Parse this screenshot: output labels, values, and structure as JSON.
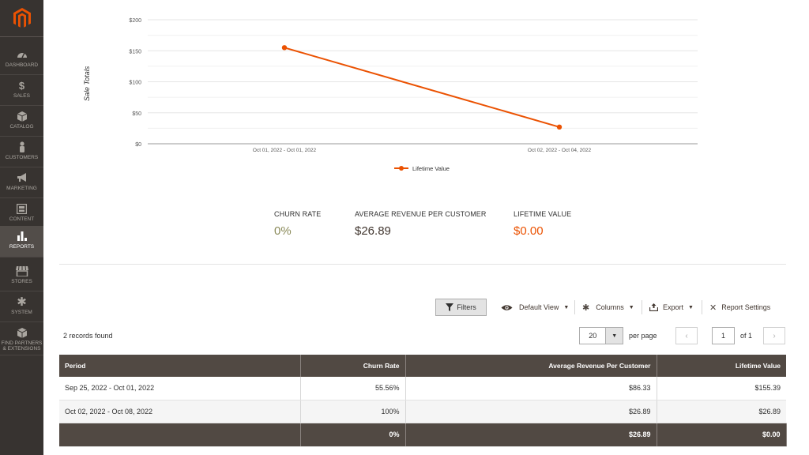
{
  "sidebar": {
    "items": [
      {
        "label": "DASHBOARD",
        "icon": "dashboard-icon"
      },
      {
        "label": "SALES",
        "icon": "dollar-icon"
      },
      {
        "label": "CATALOG",
        "icon": "box-icon"
      },
      {
        "label": "CUSTOMERS",
        "icon": "person-icon"
      },
      {
        "label": "MARKETING",
        "icon": "megaphone-icon"
      },
      {
        "label": "CONTENT",
        "icon": "layout-icon"
      },
      {
        "label": "REPORTS",
        "icon": "bar-chart-icon"
      },
      {
        "label": "STORES",
        "icon": "store-icon"
      },
      {
        "label": "SYSTEM",
        "icon": "gear-icon"
      },
      {
        "label": "FIND PARTNERS & EXTENSIONS",
        "icon": "cube-icon"
      }
    ],
    "active_item": "REPORTS",
    "colors": {
      "bg": "#373330",
      "active": "#524d49",
      "logo": "#eb5202"
    }
  },
  "chart_data": {
    "type": "line",
    "categories": [
      "Oct 01, 2022 - Oct 01, 2022",
      "Oct 02, 2022 - Oct 04, 2022"
    ],
    "series": [
      {
        "name": "Lifetime Value",
        "values": [
          155,
          27
        ],
        "color": "#eb5202"
      }
    ],
    "ylabel": "Sale Totals",
    "ylim": [
      0,
      200
    ],
    "y_ticks": [
      "$0",
      "$50",
      "$100",
      "$150",
      "$200"
    ],
    "y_tick_values": [
      0,
      50,
      100,
      150,
      200
    ],
    "grid": true,
    "legend_position": "bottom-center"
  },
  "stats": {
    "churn": {
      "label": "CHURN RATE",
      "value": "0%",
      "color": "#8b8b5a"
    },
    "arpc": {
      "label": "AVERAGE REVENUE PER CUSTOMER",
      "value": "$26.89",
      "color": "#41362f"
    },
    "ltv": {
      "label": "LIFETIME VALUE",
      "value": "$0.00",
      "color": "#eb5202"
    }
  },
  "toolbar": {
    "filters": "Filters",
    "view": "Default View",
    "columns": "Columns",
    "export": "Export",
    "settings": "Report Settings"
  },
  "pager": {
    "records": "2 records found",
    "per_page_value": "20",
    "per_page_label": "per page",
    "page": "1",
    "of": "of 1",
    "prev": "‹",
    "next": "›"
  },
  "table": {
    "headers": [
      "Period",
      "Churn Rate",
      "Average Revenue Per Customer",
      "Lifetime Value"
    ],
    "rows": [
      [
        "Sep 25, 2022 - Oct 01, 2022",
        "55.56%",
        "$86.33",
        "$155.39"
      ],
      [
        "Oct 02, 2022 - Oct 08, 2022",
        "100%",
        "$26.89",
        "$26.89"
      ]
    ],
    "totals": [
      "",
      "0%",
      "$26.89",
      "$0.00"
    ]
  }
}
